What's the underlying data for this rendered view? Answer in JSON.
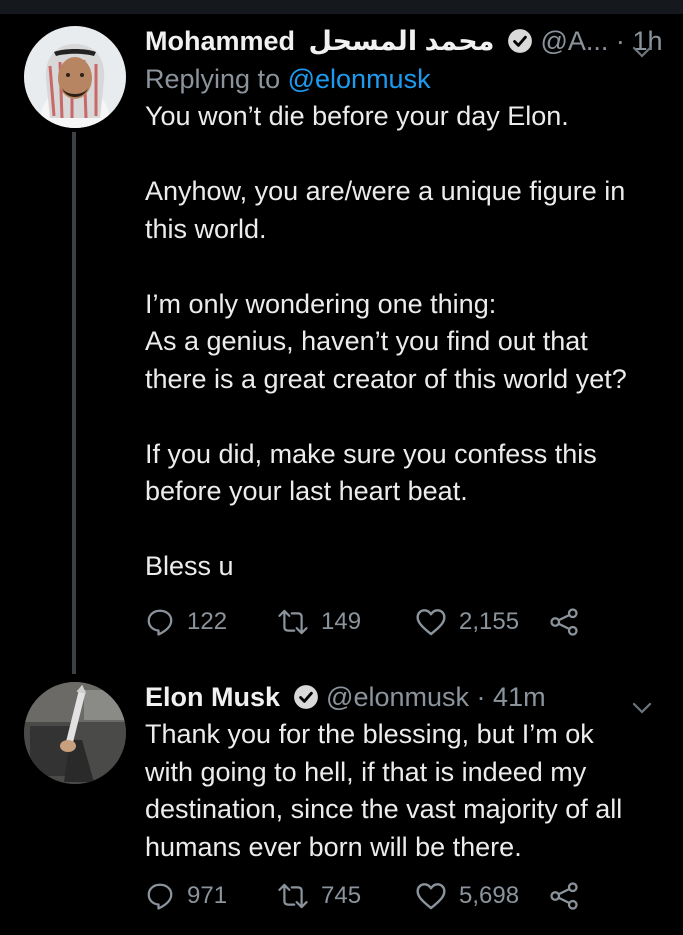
{
  "tweets": [
    {
      "author_name": "Mohammed",
      "author_name_arabic": "محمد المسحل",
      "handle": "@A...",
      "separator": "·",
      "time": "1h",
      "replying_prefix": "Replying to",
      "replying_to": "@elonmusk",
      "body": [
        "You won’t die before your day Elon.",
        "",
        "Anyhow, you are/were a unique figure in",
        "this world.",
        "",
        "I’m only wondering one thing:",
        "As a genius, haven’t you find out that",
        "there is a great creator of this world yet?",
        "",
        "If you did, make sure you confess this",
        "before your last heart beat.",
        "",
        "Bless u"
      ],
      "replies": "122",
      "retweets": "149",
      "likes": "2,155"
    },
    {
      "author_name": "Elon Musk",
      "handle": "@elonmusk",
      "separator": "·",
      "time": "41m",
      "body": [
        "Thank you for the blessing, but I’m ok",
        "with going to hell, if that is indeed my",
        "destination, since the vast majority of all",
        "humans ever born will be there."
      ],
      "replies": "971",
      "retweets": "745",
      "likes": "5,698"
    }
  ],
  "icons": {
    "reply": "reply-icon",
    "retweet": "retweet-icon",
    "like": "heart-icon",
    "share": "share-icon",
    "verified": "verified-badge-icon",
    "more": "chevron-down-icon"
  },
  "colors": {
    "background": "#000000",
    "text": "#e7e9ea",
    "secondary": "#8b949c",
    "link": "#1d9bf0"
  }
}
